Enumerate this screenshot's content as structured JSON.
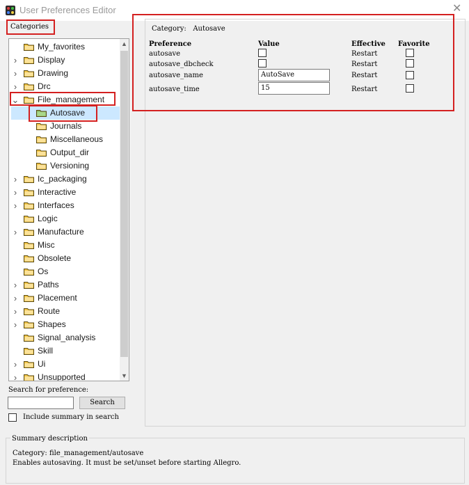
{
  "window": {
    "title": "User Preferences Editor"
  },
  "categories": {
    "label": "Categories",
    "items": [
      {
        "label": "My_favorites",
        "expander": "",
        "indent": 0,
        "selected": false
      },
      {
        "label": "Display",
        "expander": ">",
        "indent": 0,
        "selected": false
      },
      {
        "label": "Drawing",
        "expander": ">",
        "indent": 0,
        "selected": false
      },
      {
        "label": "Drc",
        "expander": ">",
        "indent": 0,
        "selected": false
      },
      {
        "label": "File_management",
        "expander": "v",
        "indent": 0,
        "selected": false
      },
      {
        "label": "Autosave",
        "expander": "",
        "indent": 1,
        "selected": true
      },
      {
        "label": "Journals",
        "expander": "",
        "indent": 1,
        "selected": false
      },
      {
        "label": "Miscellaneous",
        "expander": "",
        "indent": 1,
        "selected": false
      },
      {
        "label": "Output_dir",
        "expander": "",
        "indent": 1,
        "selected": false
      },
      {
        "label": "Versioning",
        "expander": "",
        "indent": 1,
        "selected": false
      },
      {
        "label": "Ic_packaging",
        "expander": ">",
        "indent": 0,
        "selected": false
      },
      {
        "label": "Interactive",
        "expander": ">",
        "indent": 0,
        "selected": false
      },
      {
        "label": "Interfaces",
        "expander": ">",
        "indent": 0,
        "selected": false
      },
      {
        "label": "Logic",
        "expander": "",
        "indent": 0,
        "selected": false
      },
      {
        "label": "Manufacture",
        "expander": ">",
        "indent": 0,
        "selected": false
      },
      {
        "label": "Misc",
        "expander": "",
        "indent": 0,
        "selected": false
      },
      {
        "label": "Obsolete",
        "expander": "",
        "indent": 0,
        "selected": false
      },
      {
        "label": "Os",
        "expander": "",
        "indent": 0,
        "selected": false
      },
      {
        "label": "Paths",
        "expander": ">",
        "indent": 0,
        "selected": false
      },
      {
        "label": "Placement",
        "expander": ">",
        "indent": 0,
        "selected": false
      },
      {
        "label": "Route",
        "expander": ">",
        "indent": 0,
        "selected": false
      },
      {
        "label": "Shapes",
        "expander": ">",
        "indent": 0,
        "selected": false
      },
      {
        "label": "Signal_analysis",
        "expander": "",
        "indent": 0,
        "selected": false
      },
      {
        "label": "Skill",
        "expander": "",
        "indent": 0,
        "selected": false
      },
      {
        "label": "Ui",
        "expander": ">",
        "indent": 0,
        "selected": false
      },
      {
        "label": "Unsupported",
        "expander": ">",
        "indent": 0,
        "selected": false
      }
    ]
  },
  "search": {
    "label": "Search for preference:",
    "value": "",
    "button_label": "Search",
    "include_summary_label": "Include summary in search",
    "include_summary_checked": false
  },
  "detail": {
    "category_prefix": "Category:",
    "category_name": "Autosave",
    "headers": {
      "preference": "Preference",
      "value": "Value",
      "effective": "Effective",
      "favorite": "Favorite"
    },
    "rows": [
      {
        "name": "autosave",
        "value_type": "checkbox",
        "value": "",
        "checked": false,
        "effective": "Restart",
        "favorite": false
      },
      {
        "name": "autosave_dbcheck",
        "value_type": "checkbox",
        "value": "",
        "checked": false,
        "effective": "Restart",
        "favorite": false
      },
      {
        "name": "autosave_name",
        "value_type": "text",
        "value": "AutoSave",
        "checked": false,
        "effective": "Restart",
        "favorite": false
      },
      {
        "name": "autosave_time",
        "value_type": "text",
        "value": "15",
        "checked": false,
        "effective": "Restart",
        "favorite": false
      }
    ]
  },
  "summary": {
    "title": "Summary description",
    "line1": "Category: file_management/autosave",
    "line2": "Enables autosaving. It must be set/unset before starting Allegro."
  },
  "colors": {
    "highlight": "#d42020",
    "selection": "#cce8ff",
    "folder": "#f5c748"
  }
}
